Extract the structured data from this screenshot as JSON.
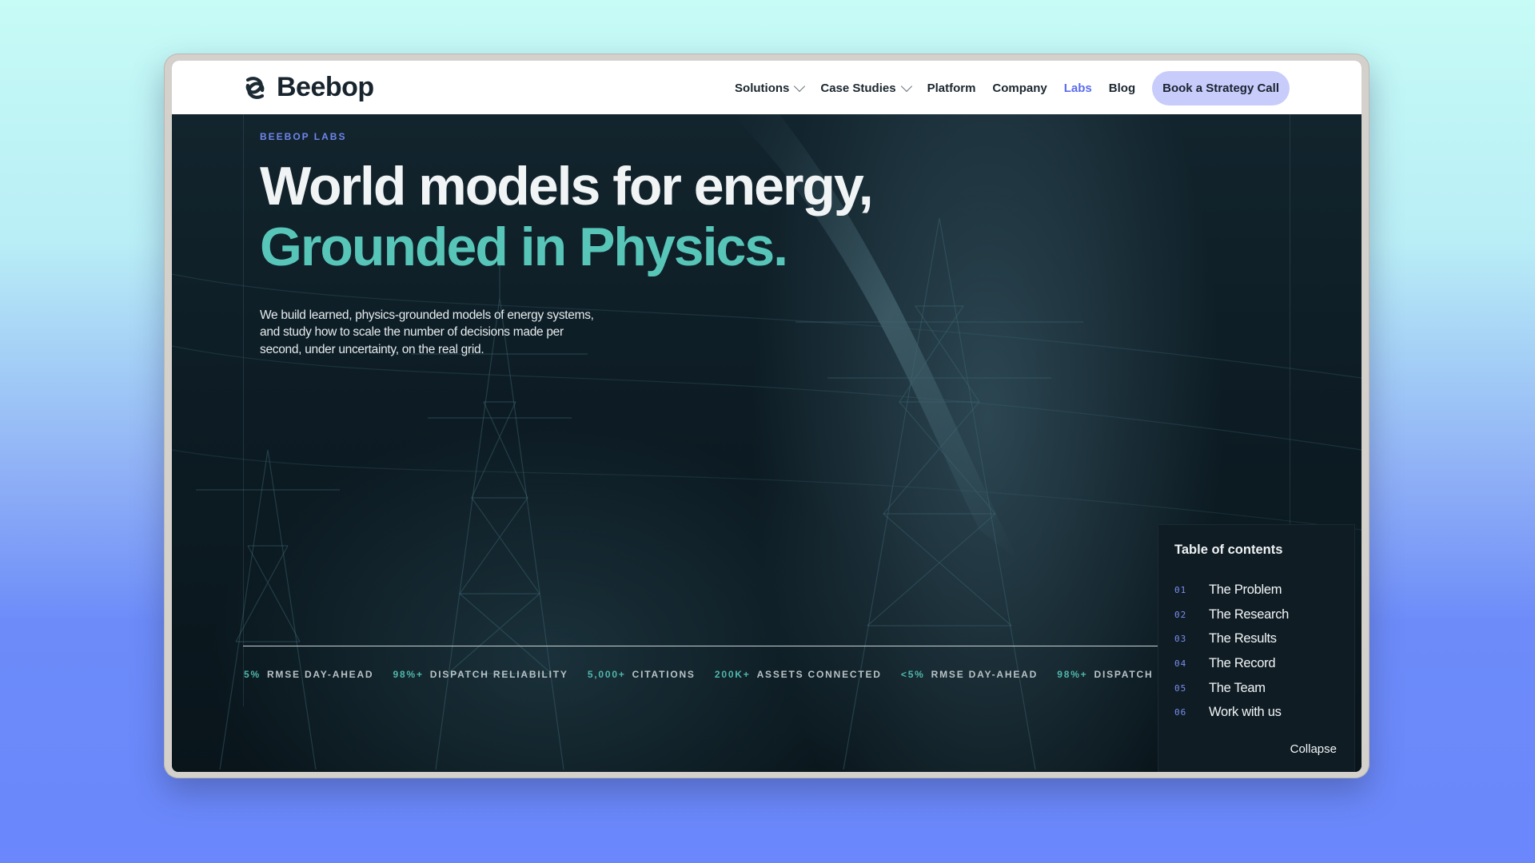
{
  "brand": {
    "name": "Beebop"
  },
  "nav": {
    "items": [
      {
        "label": "Solutions",
        "dropdown": true,
        "active": false
      },
      {
        "label": "Case Studies",
        "dropdown": true,
        "active": false
      },
      {
        "label": "Platform",
        "dropdown": false,
        "active": false
      },
      {
        "label": "Company",
        "dropdown": false,
        "active": false
      },
      {
        "label": "Labs",
        "dropdown": false,
        "active": true
      },
      {
        "label": "Blog",
        "dropdown": false,
        "active": false
      }
    ],
    "cta": "Book a Strategy Call"
  },
  "hero": {
    "eyebrow": "BEEBOP LABS",
    "title_line1": "World models for energy,",
    "title_line2": "Grounded in Physics.",
    "lede": "We build learned, physics-grounded models of energy systems, and study how to scale the number of decisions made per second, under uncertainty, on the real grid."
  },
  "ticker": [
    {
      "num": "5%",
      "label": "RMSE DAY-AHEAD"
    },
    {
      "num": "98%+",
      "label": "DISPATCH RELIABILITY"
    },
    {
      "num": "5,000+",
      "label": "CITATIONS"
    },
    {
      "num": "200K+",
      "label": "ASSETS CONNECTED"
    },
    {
      "num": "<5%",
      "label": "RMSE DAY-AHEAD"
    },
    {
      "num": "98%+",
      "label": "DISPATCH RELIABILITY"
    }
  ],
  "toc": {
    "title": "Table of contents",
    "items": [
      {
        "num": "01",
        "label": "The Problem"
      },
      {
        "num": "02",
        "label": "The Research"
      },
      {
        "num": "03",
        "label": "The Results"
      },
      {
        "num": "04",
        "label": "The Record"
      },
      {
        "num": "05",
        "label": "The Team"
      },
      {
        "num": "06",
        "label": "Work with us"
      }
    ],
    "collapse": "Collapse"
  },
  "colors": {
    "accent_teal": "#57c6b9",
    "accent_indigo": "#5b6cf0",
    "cta_bg": "#c7ccfb",
    "hero_bg": "#0d1c24"
  }
}
